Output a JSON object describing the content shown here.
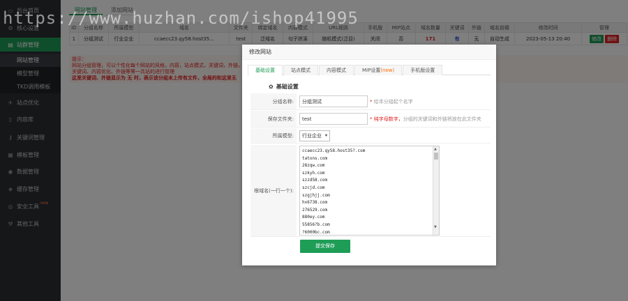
{
  "sidebar": {
    "items": [
      {
        "label": "后台首页",
        "icon": "monitor-icon"
      },
      {
        "label": "核心设置",
        "icon": "gear-icon"
      },
      {
        "label": "站群管理",
        "icon": "sitemap-icon"
      },
      {
        "label": "站点优化",
        "icon": "rocket-icon"
      },
      {
        "label": "内容库",
        "icon": "file-icon"
      },
      {
        "label": "关键词管理",
        "icon": "key-icon"
      },
      {
        "label": "模板管理",
        "icon": "template-icon"
      },
      {
        "label": "数据管理",
        "icon": "database-icon"
      },
      {
        "label": "缓存管理",
        "icon": "cache-icon"
      },
      {
        "label": "安全工具",
        "icon": "shield-icon",
        "badge": "new"
      },
      {
        "label": "其他工具",
        "icon": "tool-icon"
      }
    ],
    "sub_items": [
      "网站管理",
      "模型管理",
      "TKD调用模板"
    ]
  },
  "main": {
    "tabs": [
      "网站管理",
      "添加网站"
    ],
    "table": {
      "headers": [
        "ID",
        "分组名称",
        "所属模型",
        "域名",
        "文件夹",
        "绑定域名",
        "内容模式",
        "URL规则",
        "手机版",
        "MIP站点",
        "域名数量",
        "关键词",
        "外链",
        "域名前缀",
        "修改时间",
        "管理"
      ],
      "row": [
        "1",
        "分组测试",
        "行业企业",
        "ccaecc23.qy58.host35...",
        "test",
        "泛域名",
        "句子拼凑",
        "随机模式(泛目)",
        "关闭",
        "否",
        "171",
        "有",
        "无",
        "自动生成",
        "2023-05-13 20:40"
      ],
      "edit_label": "修改",
      "delete_label": "删除"
    },
    "tips": {
      "title": "提示：",
      "line1": "网站分组管理，可以个性化每个网站的风格，内容，站点模式，关键词，外链，",
      "line2": "关键词、内容优化、外链等等一共站的进行管理",
      "line3": "这里关键词、外链显示为 无 时，表示该分组未上传有文件，全局的和这里无"
    }
  },
  "modal": {
    "title": "修改网站",
    "tabs": [
      {
        "label": "基础设置",
        "active": true
      },
      {
        "label": "站点模式"
      },
      {
        "label": "内容模式"
      },
      {
        "label": "MIP设置",
        "new": "(new)"
      },
      {
        "label": "手机版设置"
      }
    ],
    "section_title": "基础设置",
    "fields": {
      "group_name": {
        "label": "分组名称:",
        "value": "分组测试",
        "hint": "给本分组起个名字"
      },
      "folder": {
        "label": "保存文件夹:",
        "value": "test",
        "hint_em": "纯字母数字，",
        "hint": "分组的关键词和外链将放在此文件夹"
      },
      "model": {
        "label": "所属模型:",
        "value": "行业企业"
      },
      "domains": {
        "label": "根域名(一行一个):",
        "values": [
          "ccaecc23.qy58.host35?.com",
          "tatons.com",
          "28zqw.com",
          "szkyh.com",
          "szzd58.com",
          "szcjd.com",
          "szgjhjj.com",
          "hx6738.com",
          "276529.com",
          "880ey.com",
          "55856?b.com",
          "?6000bc.com"
        ]
      }
    },
    "submit_label": "提交保存"
  },
  "watermark": "https://www.huzhan.com/ishop41995"
}
